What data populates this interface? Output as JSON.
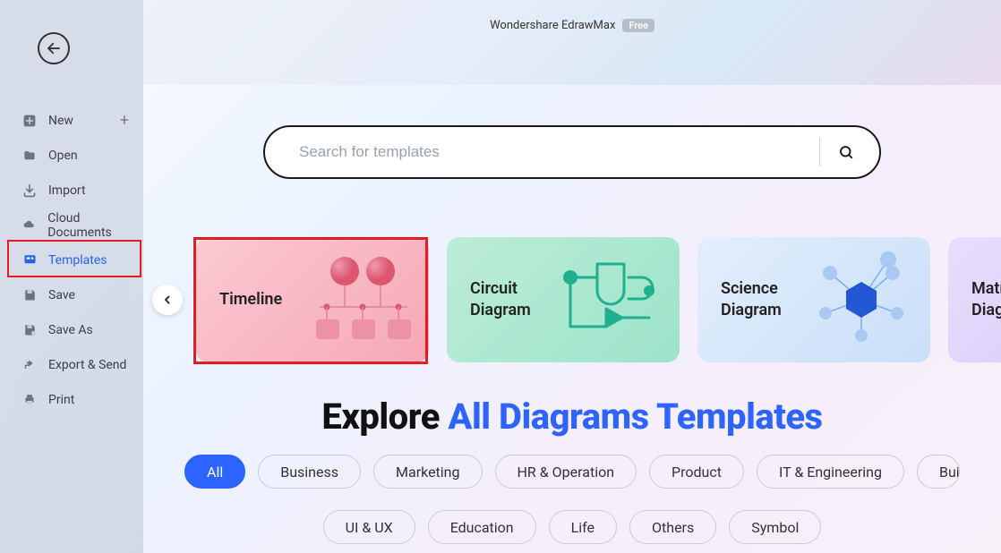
{
  "app": {
    "title": "Wondershare EdrawMax",
    "badge": "Free"
  },
  "sidebar": {
    "items": [
      {
        "label": "New",
        "icon": "plus-square",
        "hasPlus": true
      },
      {
        "label": "Open",
        "icon": "folder"
      },
      {
        "label": "Import",
        "icon": "import"
      },
      {
        "label": "Cloud Documents",
        "icon": "cloud"
      },
      {
        "label": "Templates",
        "icon": "template",
        "active": true
      },
      {
        "label": "Save",
        "icon": "save"
      },
      {
        "label": "Save As",
        "icon": "save-as"
      },
      {
        "label": "Export & Send",
        "icon": "export"
      },
      {
        "label": "Print",
        "icon": "print"
      }
    ]
  },
  "search": {
    "placeholder": "Search for templates"
  },
  "cards": [
    {
      "title": "Timeline",
      "kind": "timeline"
    },
    {
      "title": "Circuit Diagram",
      "kind": "circuit"
    },
    {
      "title": "Science Diagram",
      "kind": "science"
    },
    {
      "title": "Matrix Diagram",
      "kind": "matrix",
      "truncated": "Matri\nDiagr"
    }
  ],
  "heading": {
    "prefix": "Explore ",
    "highlight": "All Diagrams Templates"
  },
  "chips": {
    "row1": [
      "All",
      "Business",
      "Marketing",
      "HR & Operation",
      "Product",
      "IT & Engineering",
      "Buil"
    ],
    "row2": [
      "UI & UX",
      "Education",
      "Life",
      "Others",
      "Symbol"
    ]
  }
}
